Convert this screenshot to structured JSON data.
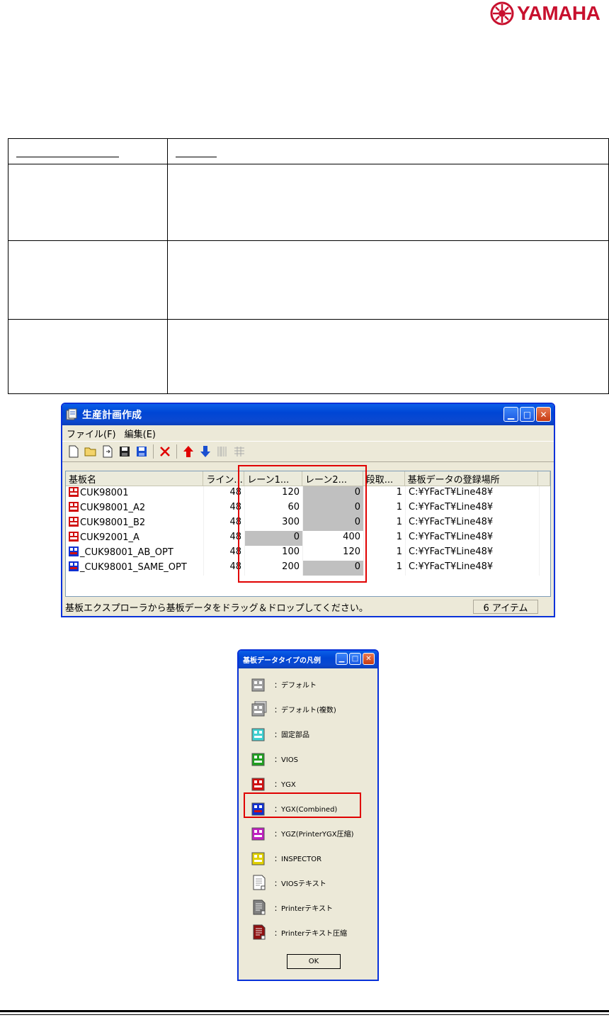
{
  "logo": {
    "text": "YAMAHA"
  },
  "plan_window": {
    "title": "生産計画作成",
    "menu": [
      "ファイル(F)",
      "編集(E)"
    ],
    "columns": [
      "基板名",
      "ライン...",
      "レーン1...",
      "レーン2...",
      "段取...",
      "基板データの登録場所"
    ],
    "rows": [
      {
        "name": "CUK98001",
        "line": "48",
        "lane1": "120",
        "lane2": "0",
        "setup": "1",
        "location": "C:¥YFacT¥Line48¥",
        "icon": "ygx-icon"
      },
      {
        "name": "CUK98001_A2",
        "line": "48",
        "lane1": "60",
        "lane2": "0",
        "setup": "1",
        "location": "C:¥YFacT¥Line48¥",
        "icon": "ygx-icon"
      },
      {
        "name": "CUK98001_B2",
        "line": "48",
        "lane1": "300",
        "lane2": "0",
        "setup": "1",
        "location": "C:¥YFacT¥Line48¥",
        "icon": "ygx-icon"
      },
      {
        "name": "CUK92001_A",
        "line": "48",
        "lane1": "0",
        "lane2": "400",
        "setup": "1",
        "location": "C:¥YFacT¥Line48¥",
        "icon": "ygx-icon"
      },
      {
        "name": "_CUK98001_AB_OPT",
        "line": "48",
        "lane1": "100",
        "lane2": "120",
        "setup": "1",
        "location": "C:¥YFacT¥Line48¥",
        "icon": "ygx-combined-icon"
      },
      {
        "name": "_CUK98001_SAME_OPT",
        "line": "48",
        "lane1": "200",
        "lane2": "0",
        "setup": "1",
        "location": "C:¥YFacT¥Line48¥",
        "icon": "ygx-combined-icon"
      }
    ],
    "status_text": "基板エクスプローラから基板データをドラッグ＆ドロップしてください。",
    "status_count": "6 アイテム"
  },
  "legend_window": {
    "title": "基板データタイプの凡例",
    "items": [
      {
        "label": "：デフォルト",
        "icon": "default-icon",
        "color": "#a0a0a0"
      },
      {
        "label": "：デフォルト(複数)",
        "icon": "default-multi-icon",
        "color": "#a0a0a0"
      },
      {
        "label": "：固定部品",
        "icon": "fixed-part-icon",
        "color": "#40d0d0"
      },
      {
        "label": "：VIOS",
        "icon": "vios-icon",
        "color": "#20a020"
      },
      {
        "label": "：YGX",
        "icon": "ygx-icon",
        "color": "#d01010"
      },
      {
        "label": "：YGX(Combined)",
        "icon": "ygx-combined-icon",
        "color": "#1030d0"
      },
      {
        "label": "：YGZ(PrinterYGX圧縮)",
        "icon": "ygz-icon",
        "color": "#c020c0"
      },
      {
        "label": "：INSPECTOR",
        "icon": "inspector-icon",
        "color": "#e0d000"
      },
      {
        "label": "：VIOSテキスト",
        "icon": "vios-text-icon",
        "color": "#ffffff"
      },
      {
        "label": "：Printerテキスト",
        "icon": "printer-text-icon",
        "color": "#808080"
      },
      {
        "label": "：Printerテキスト圧縮",
        "icon": "printer-text-compressed-icon",
        "color": "#901010"
      }
    ],
    "ok_label": "OK"
  },
  "colors": {
    "accent_red": "#e00000",
    "title_blue": "#0a5fe8",
    "brand": "#c8102e"
  }
}
